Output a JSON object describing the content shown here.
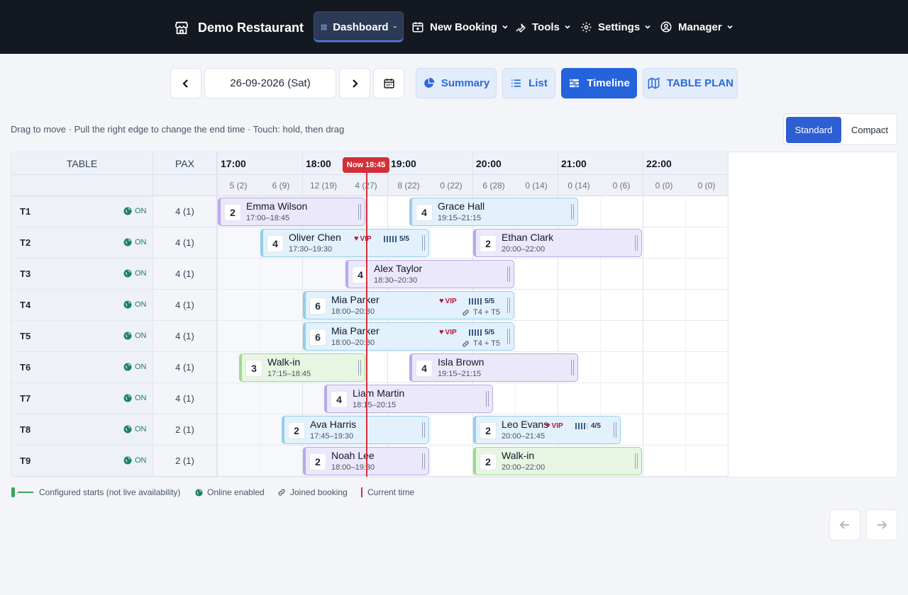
{
  "nav": {
    "brand": "Demo Restaurant",
    "items": [
      {
        "label": "Dashboard",
        "active": true
      },
      {
        "label": "New Booking"
      },
      {
        "label": "Tools"
      },
      {
        "label": "Settings"
      },
      {
        "label": "Manager"
      }
    ]
  },
  "toolbar": {
    "date": "26-09-2026 (Sat)",
    "views": [
      {
        "label": "Summary"
      },
      {
        "label": "List"
      },
      {
        "label": "Timeline",
        "active": true
      },
      {
        "label": "TABLE PLAN"
      }
    ]
  },
  "hint": "Drag to move · Pull the right edge to change the end time · Touch: hold, then drag",
  "density": {
    "standard": "Standard",
    "compact": "Compact",
    "selected": "Standard"
  },
  "timeline": {
    "col_table": "TABLE",
    "col_pax": "PAX",
    "hours": [
      "17:00",
      "18:00",
      "19:00",
      "20:00",
      "21:00",
      "22:00"
    ],
    "slot_counts": [
      "5 (2)",
      "6 (9)",
      "12 (19)",
      "4 (27)",
      "8 (22)",
      "0 (22)",
      "6 (28)",
      "0 (14)",
      "0 (14)",
      "0 (6)",
      "0 (0)",
      "0 (0)"
    ],
    "now_label": "Now 18:45",
    "online_label": "ON",
    "vip_label": "VIP",
    "tables": [
      {
        "name": "T1",
        "pax": "4 (1)"
      },
      {
        "name": "T2",
        "pax": "4 (1)"
      },
      {
        "name": "T3",
        "pax": "4 (1)"
      },
      {
        "name": "T4",
        "pax": "4 (1)"
      },
      {
        "name": "T5",
        "pax": "4 (1)"
      },
      {
        "name": "T6",
        "pax": "4 (1)"
      },
      {
        "name": "T7",
        "pax": "4 (1)"
      },
      {
        "name": "T8",
        "pax": "2 (1)"
      },
      {
        "name": "T9",
        "pax": "2 (1)"
      }
    ],
    "bookings": [
      {
        "row": 0,
        "pax": "2",
        "name": "Emma Wilson",
        "time": "17:00–18:45",
        "start": 17.0,
        "end": 18.75,
        "color": "purple"
      },
      {
        "row": 0,
        "pax": "4",
        "name": "Grace Hall",
        "time": "19:15–21:15",
        "start": 19.25,
        "end": 21.25,
        "color": "blue"
      },
      {
        "row": 1,
        "pax": "4",
        "name": "Oliver Chen",
        "time": "17:30–19:30",
        "start": 17.5,
        "end": 19.5,
        "color": "blue",
        "vip": true,
        "rating": "5/5",
        "rating_bars": 5
      },
      {
        "row": 1,
        "pax": "2",
        "name": "Ethan Clark",
        "time": "20:00–22:00",
        "start": 20.0,
        "end": 22.0,
        "color": "purple"
      },
      {
        "row": 2,
        "pax": "4",
        "name": "Alex Taylor",
        "time": "18:30–20:30",
        "start": 18.5,
        "end": 20.5,
        "color": "purple"
      },
      {
        "row": 3,
        "pax": "6",
        "name": "Mia Parker",
        "time": "18:00–20:30",
        "start": 18.0,
        "end": 20.5,
        "color": "blue",
        "vip": true,
        "rating": "5/5",
        "rating_bars": 5,
        "joined": "T4 + T5"
      },
      {
        "row": 4,
        "pax": "6",
        "name": "Mia Parker",
        "time": "18:00–20:30",
        "start": 18.0,
        "end": 20.5,
        "color": "blue",
        "vip": true,
        "rating": "5/5",
        "rating_bars": 5,
        "joined": "T4 + T5"
      },
      {
        "row": 5,
        "pax": "3",
        "name": "Walk-in",
        "time": "17:15–18:45",
        "start": 17.25,
        "end": 18.75,
        "color": "green"
      },
      {
        "row": 5,
        "pax": "4",
        "name": "Isla Brown",
        "time": "19:15–21:15",
        "start": 19.25,
        "end": 21.25,
        "color": "purple"
      },
      {
        "row": 6,
        "pax": "4",
        "name": "Liam Martin",
        "time": "18:15–20:15",
        "start": 18.25,
        "end": 20.25,
        "color": "purple"
      },
      {
        "row": 7,
        "pax": "2",
        "name": "Ava Harris",
        "time": "17:45–19:30",
        "start": 17.75,
        "end": 19.5,
        "color": "blue"
      },
      {
        "row": 7,
        "pax": "2",
        "name": "Leo Evans",
        "time": "20:00–21:45",
        "start": 20.0,
        "end": 21.75,
        "color": "blue",
        "vip": true,
        "rating": "4/5",
        "rating_bars": 4
      },
      {
        "row": 8,
        "pax": "2",
        "name": "Noah Lee",
        "time": "18:00–19:30",
        "start": 18.0,
        "end": 19.5,
        "color": "purple"
      },
      {
        "row": 8,
        "pax": "2",
        "name": "Walk-in",
        "time": "20:00–22:00",
        "start": 20.0,
        "end": 22.0,
        "color": "green"
      }
    ]
  },
  "legend": {
    "configured": "Configured starts (not live availability)",
    "online": "Online enabled",
    "joined": "Joined booking",
    "current": "Current time"
  },
  "colors": {
    "nav_bg": "#141820",
    "primary": "#2563dd",
    "now_line": "#d32f3a",
    "purple_fill": "#ece8fb",
    "purple_border": "#b9a8ec",
    "blue_fill": "#e2f1fb",
    "blue_border": "#94cdea",
    "green_fill": "#e7f6e3",
    "green_border": "#9fd98f"
  }
}
